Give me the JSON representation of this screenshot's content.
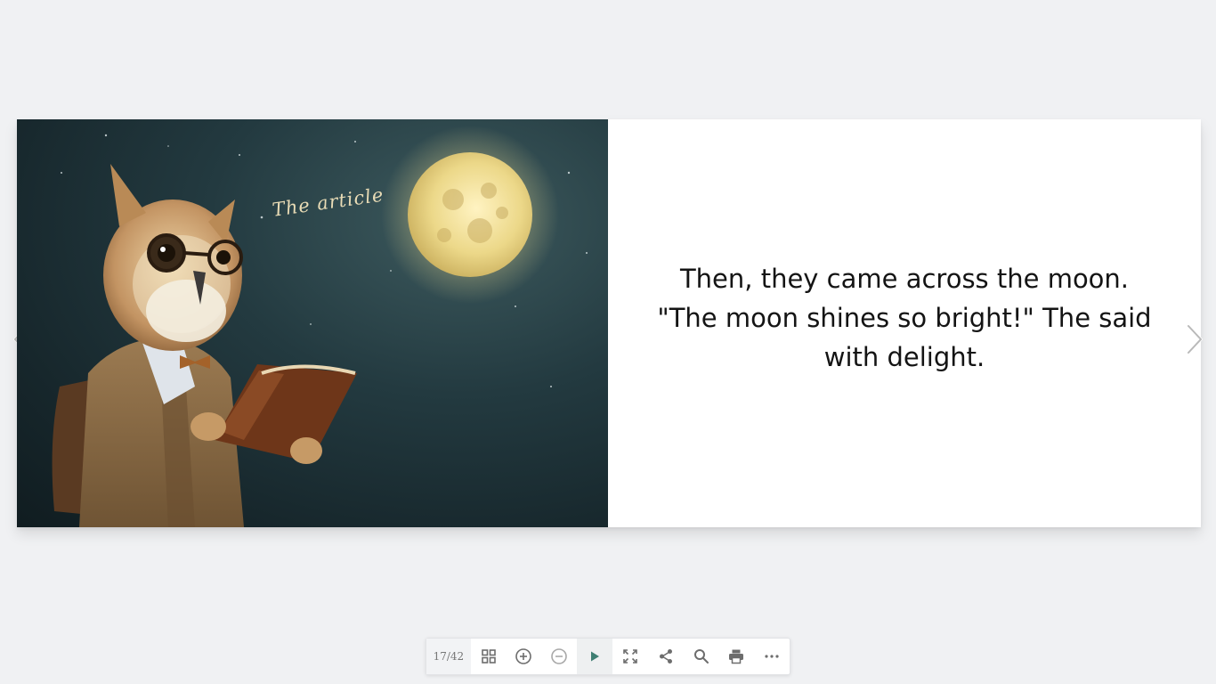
{
  "book": {
    "right_page_text": "Then, they came across the moon. \"The moon shines so bright!\" The said with delight.",
    "illustration": {
      "subject": "owl-with-glasses-reading-book-under-full-moon",
      "caption": "The article"
    }
  },
  "navigation": {
    "prev_icon": "chevron-left-icon",
    "next_icon": "chevron-right-icon"
  },
  "toolbar": {
    "page_counter": "17/42",
    "buttons": [
      {
        "id": "thumbnails",
        "icon": "grid-icon"
      },
      {
        "id": "zoom-in",
        "icon": "zoom-in-icon"
      },
      {
        "id": "zoom-out",
        "icon": "zoom-out-icon"
      },
      {
        "id": "autoplay",
        "icon": "play-icon"
      },
      {
        "id": "fullscreen",
        "icon": "fullscreen-icon"
      },
      {
        "id": "share",
        "icon": "share-icon"
      },
      {
        "id": "search",
        "icon": "search-icon"
      },
      {
        "id": "print",
        "icon": "print-icon"
      },
      {
        "id": "more",
        "icon": "more-icon"
      }
    ]
  },
  "colors": {
    "background": "#f0f1f3",
    "icon": "#6d6d6d",
    "play_accent": "#3f7f73"
  }
}
